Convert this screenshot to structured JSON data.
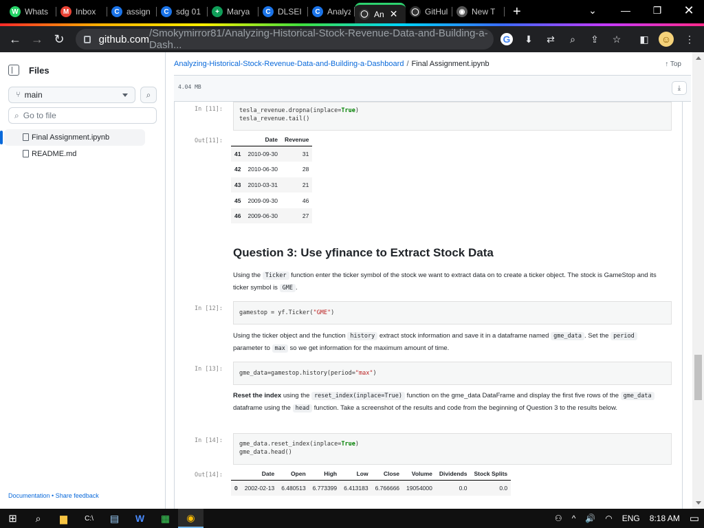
{
  "browser": {
    "tabs": [
      {
        "label": "Whats",
        "icon": "whatsapp-icon",
        "color": "#25d366",
        "glyph": "W"
      },
      {
        "label": "Inbox",
        "icon": "gmail-icon",
        "color": "#ea4335",
        "glyph": "M"
      },
      {
        "label": "assign",
        "icon": "chat-icon",
        "color": "#1a73e8",
        "glyph": "C"
      },
      {
        "label": "sdg 01",
        "icon": "chat-icon",
        "color": "#1a73e8",
        "glyph": "C"
      },
      {
        "label": "Marya",
        "icon": "sheets-icon",
        "color": "#0f9d58",
        "glyph": "+"
      },
      {
        "label": "DLSEI",
        "icon": "chat-icon",
        "color": "#1a73e8",
        "glyph": "C"
      },
      {
        "label": "Analyz",
        "icon": "chat-icon",
        "color": "#1a73e8",
        "glyph": "C"
      },
      {
        "label": "An",
        "icon": "github-icon",
        "color": "#333333",
        "glyph": "◯",
        "active": true
      },
      {
        "label": "GitHul",
        "icon": "github-icon",
        "color": "#333333",
        "glyph": "◯"
      },
      {
        "label": "New T",
        "icon": "chrome-icon",
        "color": "#555555",
        "glyph": "◉"
      }
    ],
    "close_glyph": "✕",
    "newtab_glyph": "+",
    "url_host": "github.com",
    "url_path": "/Smokymirror81/Analyzing-Historical-Stock-Revenue-Data-and-Building-a-Dash..."
  },
  "sidebar": {
    "title": "Files",
    "branch": "main",
    "goto_placeholder": "Go to file",
    "files": [
      "Final Assignment.ipynb",
      "README.md"
    ],
    "footer": "Documentation • Share feedback"
  },
  "main": {
    "crumb_repo": "Analyzing-Historical-Stock-Revenue-Data-and-Building-a-Dashboard",
    "crumb_sep": "/",
    "crumb_file": "Final Assignment.ipynb",
    "top_label": "↑ Top",
    "size": "4.04 MB",
    "cells": {
      "in11_prompt": "In [11]:",
      "in11_line1_a": "tesla_revenue.dropna(inplace=",
      "in11_line1_kw": "True",
      "in11_line1_b": ")",
      "in11_line2": "tesla_revenue.tail()",
      "out11_prompt": "Out[11]:",
      "tesla_table": {
        "headers": [
          "",
          "Date",
          "Revenue"
        ],
        "rows": [
          [
            "41",
            "2010-09-30",
            "31"
          ],
          [
            "42",
            "2010-06-30",
            "28"
          ],
          [
            "43",
            "2010-03-31",
            "21"
          ],
          [
            "45",
            "2009-09-30",
            "46"
          ],
          [
            "46",
            "2009-06-30",
            "27"
          ]
        ]
      },
      "q3_heading": "Question 3: Use yfinance to Extract Stock Data",
      "q3_p_a": "Using the",
      "q3_p_code1": "Ticker",
      "q3_p_b": "function enter the ticker symbol of the stock we want to extract data on to create a ticker object. The stock is GameStop and its ticker symbol is",
      "q3_p_code2": "GME",
      "q3_p_c": ".",
      "in12_prompt": "In [12]:",
      "in12_a": "gamestop = yf.Ticker(",
      "in12_str": "\"GME\"",
      "in12_b": ")",
      "p2_a": "Using the ticker object and the function",
      "p2_code1": "history",
      "p2_b": "extract stock information and save it in a dataframe named",
      "p2_code2": "gme_data",
      "p2_c": ". Set the",
      "p2_code3": "period",
      "p2_d": "parameter to",
      "p2_code4": "max",
      "p2_e": "so we get information for the maximum amount of time.",
      "in13_prompt": "In [13]:",
      "in13_a": "gme_data=gamestop.history(period=",
      "in13_str": "\"max\"",
      "in13_b": ")",
      "p3_bold": "Reset the index",
      "p3_a": "using the",
      "p3_code1": "reset_index(inplace=True)",
      "p3_b": "function on the gme_data DataFrame and display the first five rows of the",
      "p3_code2": "gme_data",
      "p3_c": "dataframe using the",
      "p3_code3": "head",
      "p3_d": "function. Take a screenshot of the results and code from the beginning of Question 3 to the results below.",
      "in14_prompt": "In [14]:",
      "in14_line1_a": "gme_data.reset_index(inplace=",
      "in14_line1_kw": "True",
      "in14_line1_b": ")",
      "in14_line2": "gme_data.head()",
      "out14_prompt": "Out[14]:",
      "gme_table": {
        "headers": [
          "",
          "Date",
          "Open",
          "High",
          "Low",
          "Close",
          "Volume",
          "Dividends",
          "Stock Splits"
        ],
        "rows": [
          [
            "0",
            "2002-02-13",
            "6.480513",
            "6.773399",
            "6.413183",
            "6.766666",
            "19054000",
            "0.0",
            "0.0"
          ]
        ]
      }
    }
  },
  "taskbar": {
    "language": "ENG",
    "time": "8:18 AM"
  }
}
